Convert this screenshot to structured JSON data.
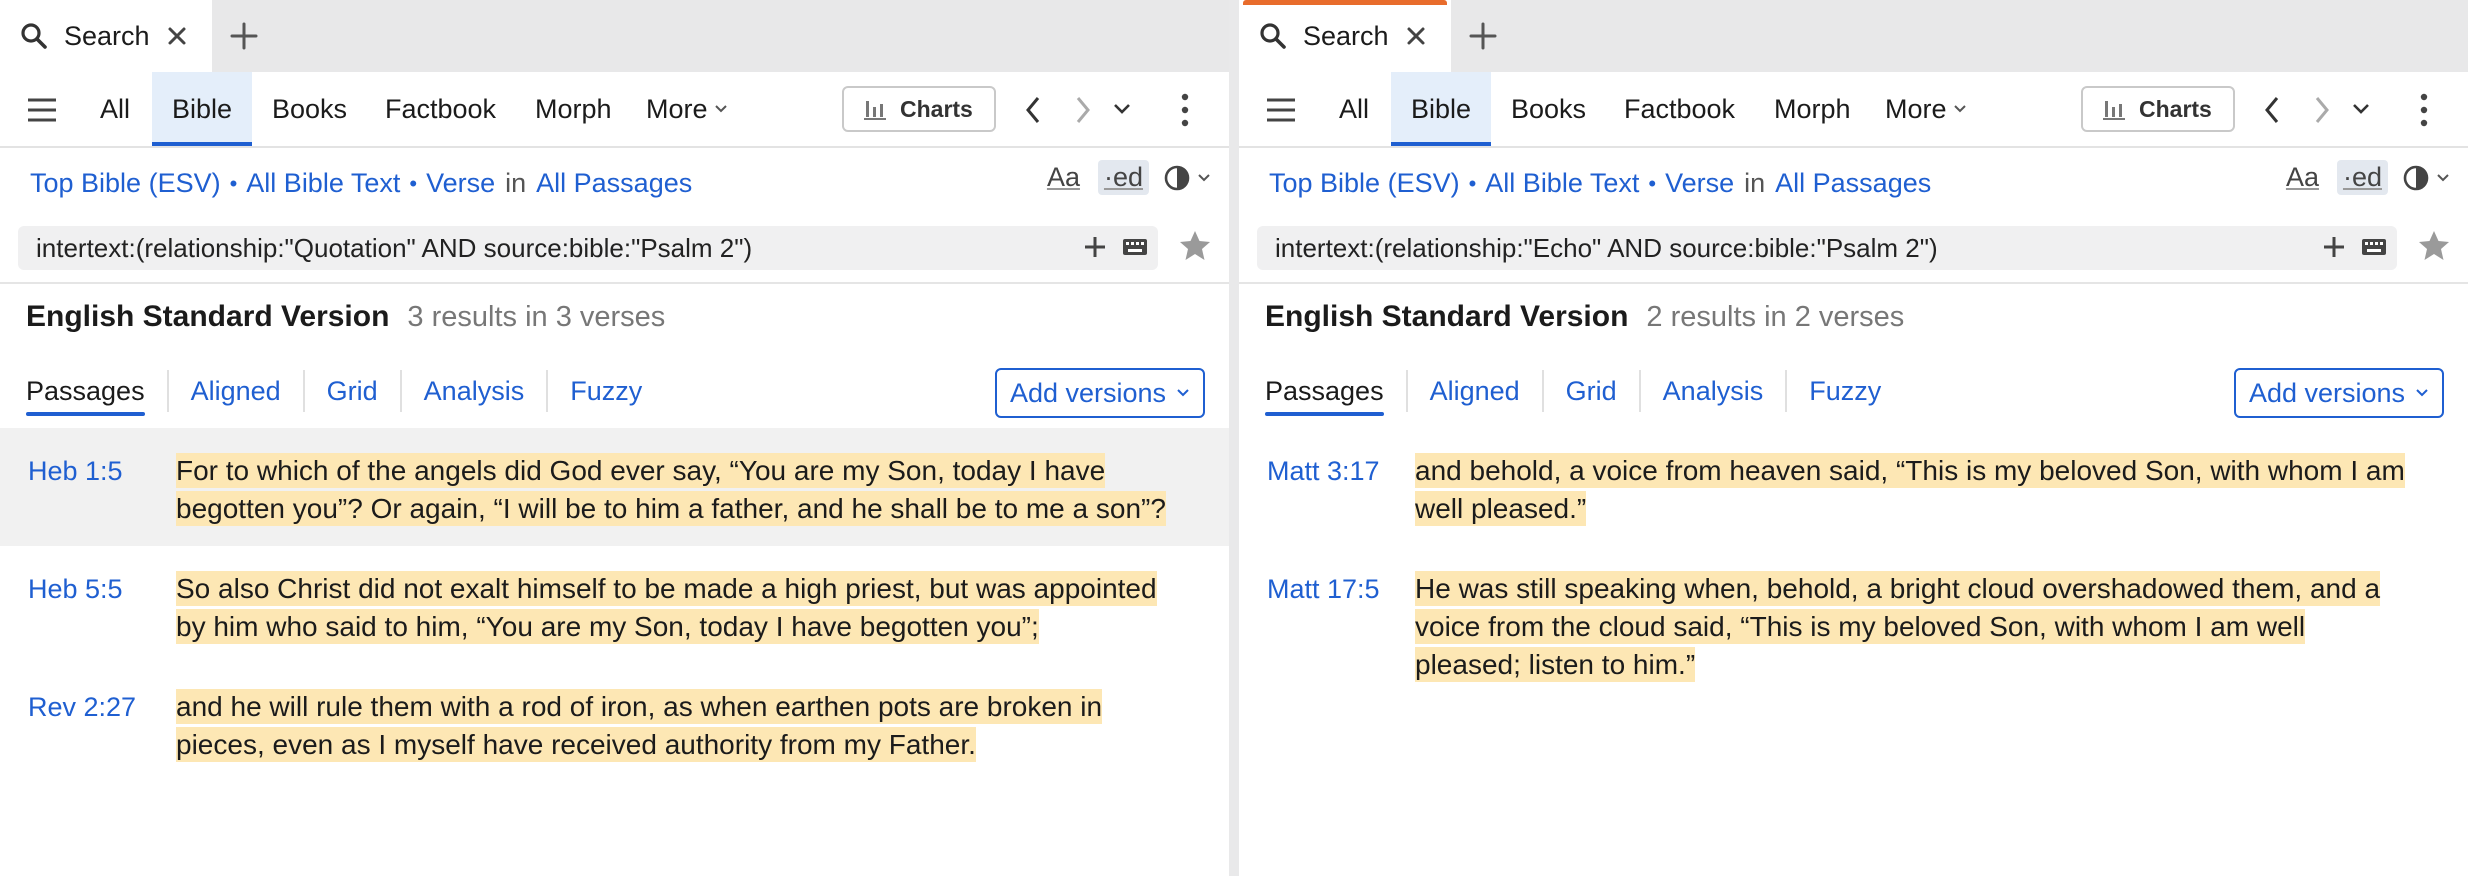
{
  "panes": [
    {
      "tab": {
        "label": "Search",
        "accent": false
      },
      "nav": {
        "all": "All",
        "bible": "Bible",
        "books": "Books",
        "factbook": "Factbook",
        "morph": "Morph",
        "more": "More",
        "charts": "Charts"
      },
      "source": {
        "resource": "Top Bible (ESV)",
        "scope": "All Bible Text",
        "unit": "Verse",
        "in": "in",
        "range": "All Passages"
      },
      "tools": {
        "aa": "Aa",
        "ed": "·ed"
      },
      "query": "intertext:(relationship:\"Quotation\" AND source:bible:\"Psalm 2\")",
      "version": {
        "name": "English Standard Version",
        "count": "3 results in 3 verses"
      },
      "views": [
        "Passages",
        "Aligned",
        "Grid",
        "Analysis",
        "Fuzzy"
      ],
      "add_versions": "Add versions",
      "results": [
        {
          "ref": "Heb 1:5",
          "text": "For to which of the angels did God ever say, “You are my Son, today I have begotten you”? Or again, “I will be to him a father, and he shall be to me a son”?"
        },
        {
          "ref": "Heb 5:5",
          "text": "So also Christ did not exalt himself to be made a high priest, but was appointed by him who said to him, “You are my Son, today I have begotten you”;"
        },
        {
          "ref": "Rev 2:27",
          "text": "and he will rule them with a rod of iron, as when earthen pots are broken in pieces, even as I myself have received authority from my Father."
        }
      ]
    },
    {
      "tab": {
        "label": "Search",
        "accent": true
      },
      "nav": {
        "all": "All",
        "bible": "Bible",
        "books": "Books",
        "factbook": "Factbook",
        "morph": "Morph",
        "more": "More",
        "charts": "Charts"
      },
      "source": {
        "resource": "Top Bible (ESV)",
        "scope": "All Bible Text",
        "unit": "Verse",
        "in": "in",
        "range": "All Passages"
      },
      "tools": {
        "aa": "Aa",
        "ed": "·ed"
      },
      "query": "intertext:(relationship:\"Echo\" AND source:bible:\"Psalm 2\")",
      "version": {
        "name": "English Standard Version",
        "count": "2 results in 2 verses"
      },
      "views": [
        "Passages",
        "Aligned",
        "Grid",
        "Analysis",
        "Fuzzy"
      ],
      "add_versions": "Add versions",
      "results": [
        {
          "ref": "Matt 3:17",
          "text": "and behold, a voice from heaven said, “This is my beloved Son, with whom I am well pleased.”"
        },
        {
          "ref": "Matt 17:5",
          "text": "He was still speaking when, behold, a bright cloud overshadowed them, and a voice from the cloud said, “This is my beloved Son, with whom I am well pleased; listen to him.”"
        }
      ]
    }
  ],
  "colors": {
    "link": "#1f5fd1",
    "highlight": "#fde7b4",
    "accent_tab": "#e86c2c",
    "selected_nav": "#e4eefa"
  }
}
